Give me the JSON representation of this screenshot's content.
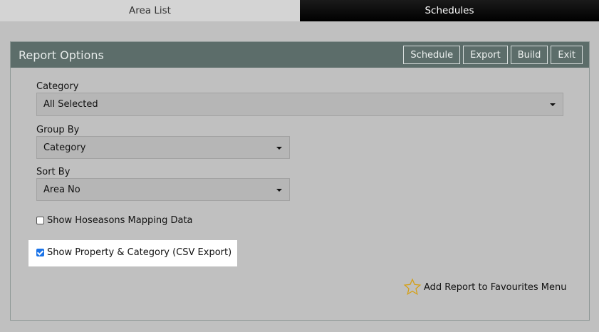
{
  "tabs": [
    {
      "label": "Area List",
      "active": true
    },
    {
      "label": "Schedules",
      "active": false
    }
  ],
  "panel": {
    "title": "Report Options",
    "buttons": {
      "schedule": "Schedule",
      "export": "Export",
      "build": "Build",
      "exit": "Exit"
    }
  },
  "fields": {
    "category": {
      "label": "Category",
      "value": "All Selected"
    },
    "group_by": {
      "label": "Group By",
      "value": "Category"
    },
    "sort_by": {
      "label": "Sort By",
      "value": "Area No"
    }
  },
  "checkboxes": {
    "hoseasons": {
      "label": "Show Hoseasons Mapping Data",
      "checked": false
    },
    "property_category": {
      "label": "Show Property & Category (CSV Export)",
      "checked": true
    }
  },
  "favourites": {
    "label": "Add Report to Favourites Menu",
    "icon": "star-outline-icon",
    "icon_color": "#d4a017"
  },
  "colors": {
    "header": "#5c6d6a",
    "background": "#c0c0c0",
    "checkbox_accent": "#1a73e8"
  }
}
